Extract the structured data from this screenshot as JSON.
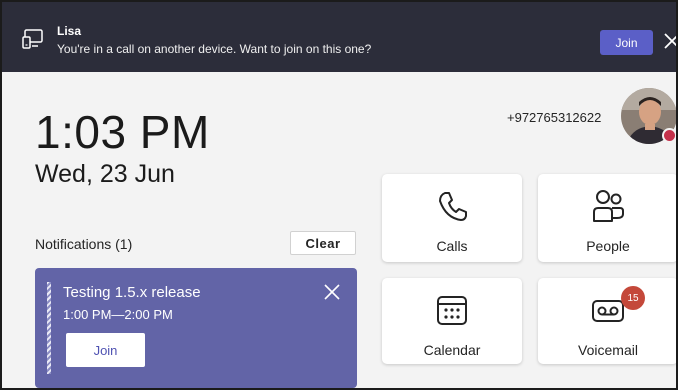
{
  "banner": {
    "caller": "Lisa",
    "message": "You're in a call on another device. Want to join on this one?",
    "join_label": "Join",
    "icons": {
      "device": "device-transfer-icon",
      "close": "close-icon"
    }
  },
  "clock": {
    "time": "1:03 PM",
    "date": "Wed, 23 Jun"
  },
  "notifications": {
    "title": "Notifications (1)",
    "clear_label": "Clear",
    "items": [
      {
        "subject": "Testing 1.5.x release",
        "time_range": "1:00 PM—2:00 PM",
        "join_label": "Join"
      }
    ]
  },
  "user": {
    "phone": "+972765312622",
    "presence": "busy",
    "presence_color": "#c4314b"
  },
  "tiles": [
    {
      "label": "Calls",
      "icon": "phone-icon"
    },
    {
      "label": "People",
      "icon": "people-icon"
    },
    {
      "label": "Calendar",
      "icon": "calendar-icon"
    },
    {
      "label": "Voicemail",
      "icon": "voicemail-icon",
      "badge": "15"
    }
  ],
  "colors": {
    "banner_bg": "#2c2d3a",
    "accent": "#5b5fc7",
    "notification_bg": "#6264a7",
    "badge": "#c4483a"
  }
}
